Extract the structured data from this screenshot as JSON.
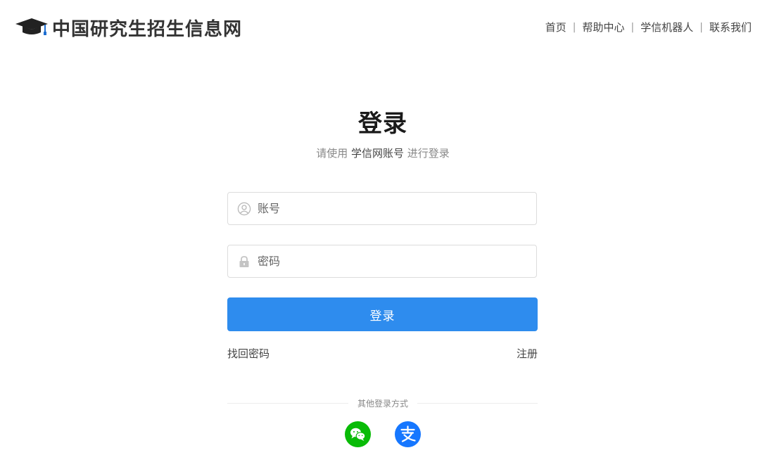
{
  "header": {
    "site_name": "中国研究生招生信息网",
    "logo_icon": "graduation-cap-icon",
    "nav": [
      {
        "label": "首页"
      },
      {
        "label": "帮助中心"
      },
      {
        "label": "学信机器人"
      },
      {
        "label": "联系我们"
      }
    ],
    "separator": "|"
  },
  "login": {
    "title": "登录",
    "subtitle_prefix": "请使用",
    "subtitle_account": "学信网账号",
    "subtitle_suffix": "进行登录",
    "account_placeholder": "账号",
    "account_icon": "user-icon",
    "password_placeholder": "密码",
    "password_icon": "lock-icon",
    "submit_label": "登录",
    "forgot_password": "找回密码",
    "register": "注册",
    "other_methods": "其他登录方式"
  },
  "social": [
    {
      "name": "wechat-icon",
      "color": "#09bb07"
    },
    {
      "name": "alipay-icon",
      "color": "#1677ff"
    }
  ],
  "colors": {
    "primary": "#2e8cee",
    "text": "#333333",
    "muted": "#888888",
    "border": "#dcdcdc"
  }
}
